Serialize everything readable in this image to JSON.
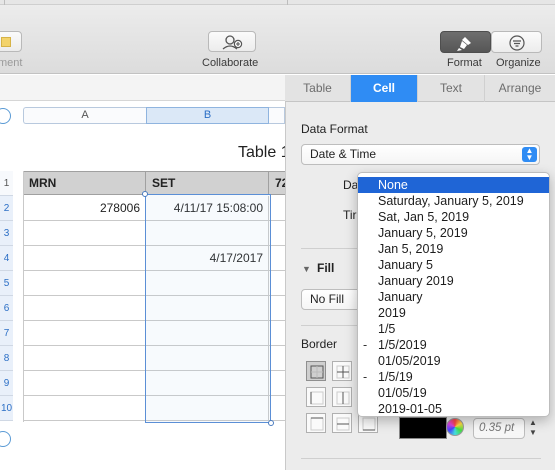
{
  "toolbar": {
    "comment_label": "ment",
    "collaborate_label": "Collaborate",
    "format_label": "Format",
    "organize_label": "Organize"
  },
  "sheet": {
    "columns": [
      "A",
      "B"
    ],
    "table_title": "Table 1",
    "headers": [
      "MRN",
      "SET",
      "72"
    ],
    "row_numbers": [
      "1",
      "2",
      "3",
      "4",
      "5",
      "6",
      "7",
      "8",
      "9",
      "10"
    ],
    "rows": [
      [
        "278006",
        "4/11/17 15:08:00",
        ""
      ],
      [
        "",
        "",
        ""
      ],
      [
        "",
        "4/17/2017",
        ""
      ],
      [
        "",
        "",
        ""
      ],
      [
        "",
        "",
        ""
      ],
      [
        "",
        "",
        ""
      ],
      [
        "",
        "",
        ""
      ],
      [
        "",
        "",
        ""
      ],
      [
        "",
        "",
        ""
      ]
    ]
  },
  "inspector": {
    "tabs": [
      "Table",
      "Cell",
      "Text",
      "Arrange"
    ],
    "active_tab": "Cell",
    "data_format_label": "Data Format",
    "data_format_value": "Date & Time",
    "date_label": "Da",
    "time_label": "Tir",
    "fill_label": "Fill",
    "fill_value": "No Fill",
    "border_label": "Border",
    "border_width": "0.35 pt"
  },
  "date_dropdown": {
    "selected": "None",
    "options": [
      {
        "label": "None",
        "marker": ""
      },
      {
        "label": "Saturday, January 5, 2019",
        "marker": ""
      },
      {
        "label": "Sat, Jan 5, 2019",
        "marker": ""
      },
      {
        "label": "January 5, 2019",
        "marker": ""
      },
      {
        "label": "Jan 5, 2019",
        "marker": ""
      },
      {
        "label": "January 5",
        "marker": ""
      },
      {
        "label": "January 2019",
        "marker": ""
      },
      {
        "label": "January",
        "marker": ""
      },
      {
        "label": "2019",
        "marker": ""
      },
      {
        "label": "1/5",
        "marker": ""
      },
      {
        "label": "1/5/2019",
        "marker": "-"
      },
      {
        "label": "01/05/2019",
        "marker": ""
      },
      {
        "label": "1/5/19",
        "marker": "-"
      },
      {
        "label": "01/05/19",
        "marker": ""
      },
      {
        "label": "2019-01-05",
        "marker": ""
      }
    ]
  },
  "colors": {
    "accent": "#2f8cf4",
    "selection": "#1f65d6",
    "header_fill": "#d1d1d1"
  }
}
